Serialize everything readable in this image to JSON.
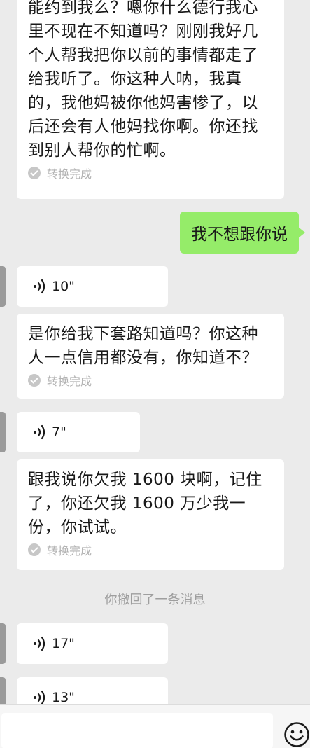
{
  "messages": {
    "m1": {
      "text": "能约到我么？嗯你什么德行我心里不现在不知道吗？刚刚我好几个人帮我把你以前的事情都走了给我听了。你这种人呐，我真的，我他妈被你他妈害惨了，以后还会有人他妈找你啊。你还找到别人帮你的忙啊。",
      "status": "转换完成"
    },
    "sent": {
      "text": "我不想跟你说"
    },
    "v1": {
      "duration": "10\""
    },
    "m2": {
      "text": "是你给我下套路知道吗？你这种人一点信用都没有，你知道不？",
      "status": "转换完成"
    },
    "v2": {
      "duration": "7\""
    },
    "m3": {
      "text": "跟我说你欠我 1600 块啊，记住了，你还欠我 1600 万少我一份，你试试。",
      "status": "转换完成"
    },
    "recall": {
      "text": "你撤回了一条消息"
    },
    "v3": {
      "duration": "17\""
    },
    "v4": {
      "duration": "13\""
    }
  },
  "icons": {
    "voice": "voice-wave-icon",
    "check": "check-icon",
    "emoji": "smiley-icon"
  },
  "colors": {
    "background": "#ebebeb",
    "sent_bubble": "#95ec69",
    "received_bubble": "#ffffff"
  }
}
